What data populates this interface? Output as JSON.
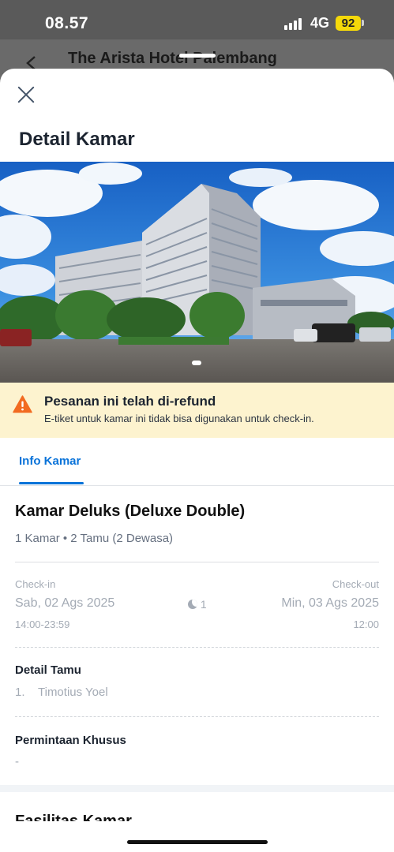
{
  "status_bar": {
    "time": "08.57",
    "network": "4G",
    "battery": "92"
  },
  "background_page": {
    "title": "The Arista Hotel Palembang"
  },
  "sheet": {
    "title": "Detail Kamar",
    "close_icon": "close-icon"
  },
  "banner": {
    "title": "Pesanan ini telah di-refund",
    "subtitle": "E-tiket untuk kamar ini tidak bisa digunakan untuk check-in.",
    "icon": "warning-icon",
    "color": "#fdf3cf"
  },
  "tabs": [
    {
      "label": "Info Kamar",
      "active": true
    }
  ],
  "room": {
    "name": "Kamar Deluks (Deluxe Double)",
    "summary": "1 Kamar • 2 Tamu (2 Dewasa)"
  },
  "stay": {
    "checkin_label": "Check-in",
    "checkin_date": "Sab, 02 Ags 2025",
    "checkin_time": "14:00-23:59",
    "nights": "1",
    "checkout_label": "Check-out",
    "checkout_date": "Min, 03 Ags 2025",
    "checkout_time": "12:00"
  },
  "guests": {
    "heading": "Detail Tamu",
    "items": [
      {
        "number": "1.",
        "name": "Timotius Yoel"
      }
    ]
  },
  "special_request": {
    "heading": "Permintaan Khusus",
    "value": "-"
  },
  "next_section": {
    "heading": "Fasilitas Kamar"
  },
  "colors": {
    "accent": "#0a73d9",
    "warning": "#f26b21"
  }
}
